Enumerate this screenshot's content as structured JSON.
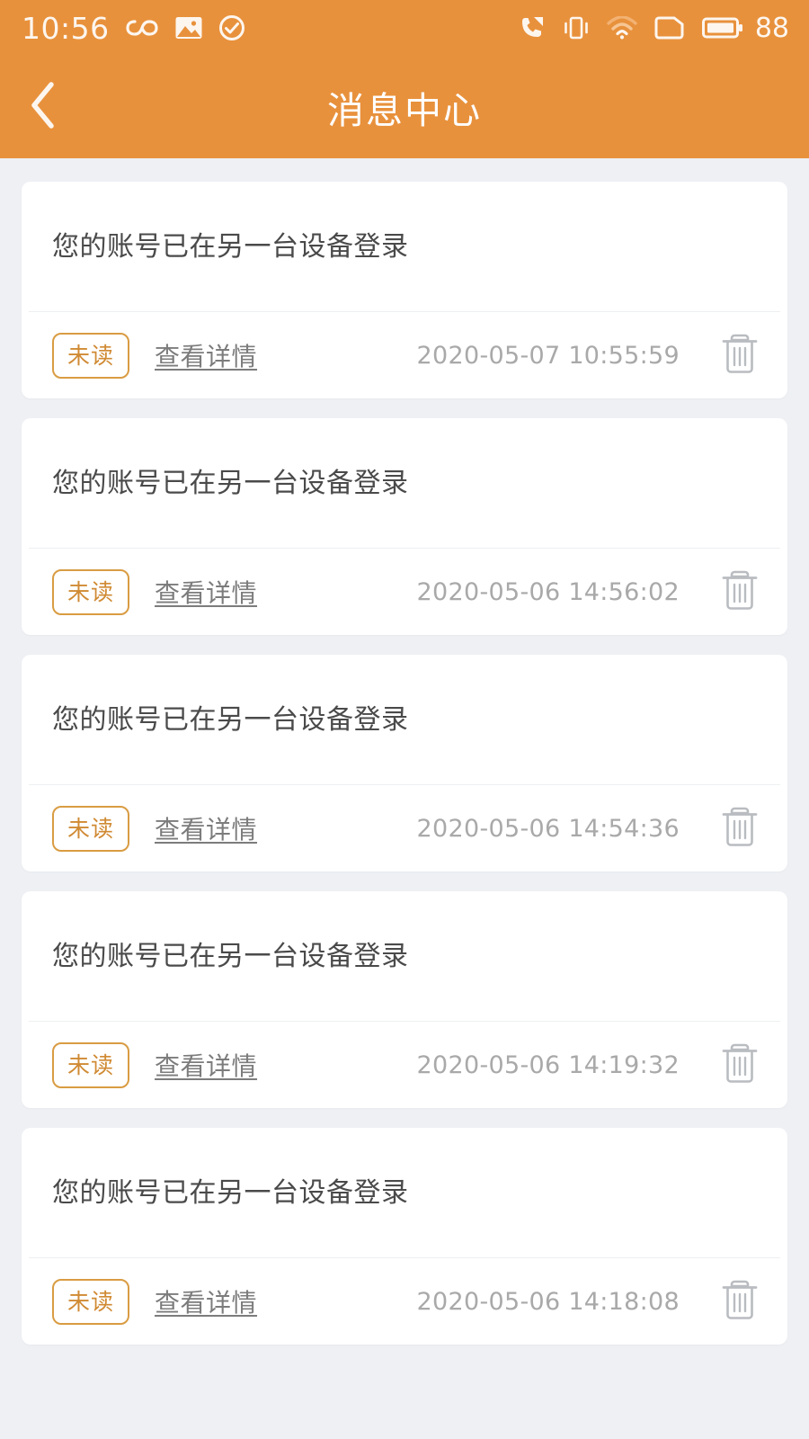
{
  "status_bar": {
    "time": "10:56",
    "battery_level": "88",
    "left_icons": [
      "infinity-icon",
      "photo-icon",
      "check-circle-icon"
    ],
    "right_icons": [
      "missed-call-icon",
      "vibrate-icon",
      "wifi-icon",
      "sim-card-icon",
      "battery-icon"
    ]
  },
  "header": {
    "title": "消息中心",
    "back_icon": "chevron-left-icon",
    "background_color": "#e8913c",
    "title_color": "#ffffff"
  },
  "theme": {
    "accent": "#e8913c",
    "badge_border": "#d99c43",
    "badge_text": "#d08a33",
    "page_background": "#eef0f4",
    "card_background": "#ffffff"
  },
  "messages": [
    {
      "title": "您的账号已在另一台设备登录",
      "status_badge": "未读",
      "detail_link": "查看详情",
      "timestamp": "2020-05-07 10:55:59",
      "delete_icon": "trash-icon"
    },
    {
      "title": "您的账号已在另一台设备登录",
      "status_badge": "未读",
      "detail_link": "查看详情",
      "timestamp": "2020-05-06 14:56:02",
      "delete_icon": "trash-icon"
    },
    {
      "title": "您的账号已在另一台设备登录",
      "status_badge": "未读",
      "detail_link": "查看详情",
      "timestamp": "2020-05-06 14:54:36",
      "delete_icon": "trash-icon"
    },
    {
      "title": "您的账号已在另一台设备登录",
      "status_badge": "未读",
      "detail_link": "查看详情",
      "timestamp": "2020-05-06 14:19:32",
      "delete_icon": "trash-icon"
    },
    {
      "title": "您的账号已在另一台设备登录",
      "status_badge": "未读",
      "detail_link": "查看详情",
      "timestamp": "2020-05-06 14:18:08",
      "delete_icon": "trash-icon"
    }
  ]
}
